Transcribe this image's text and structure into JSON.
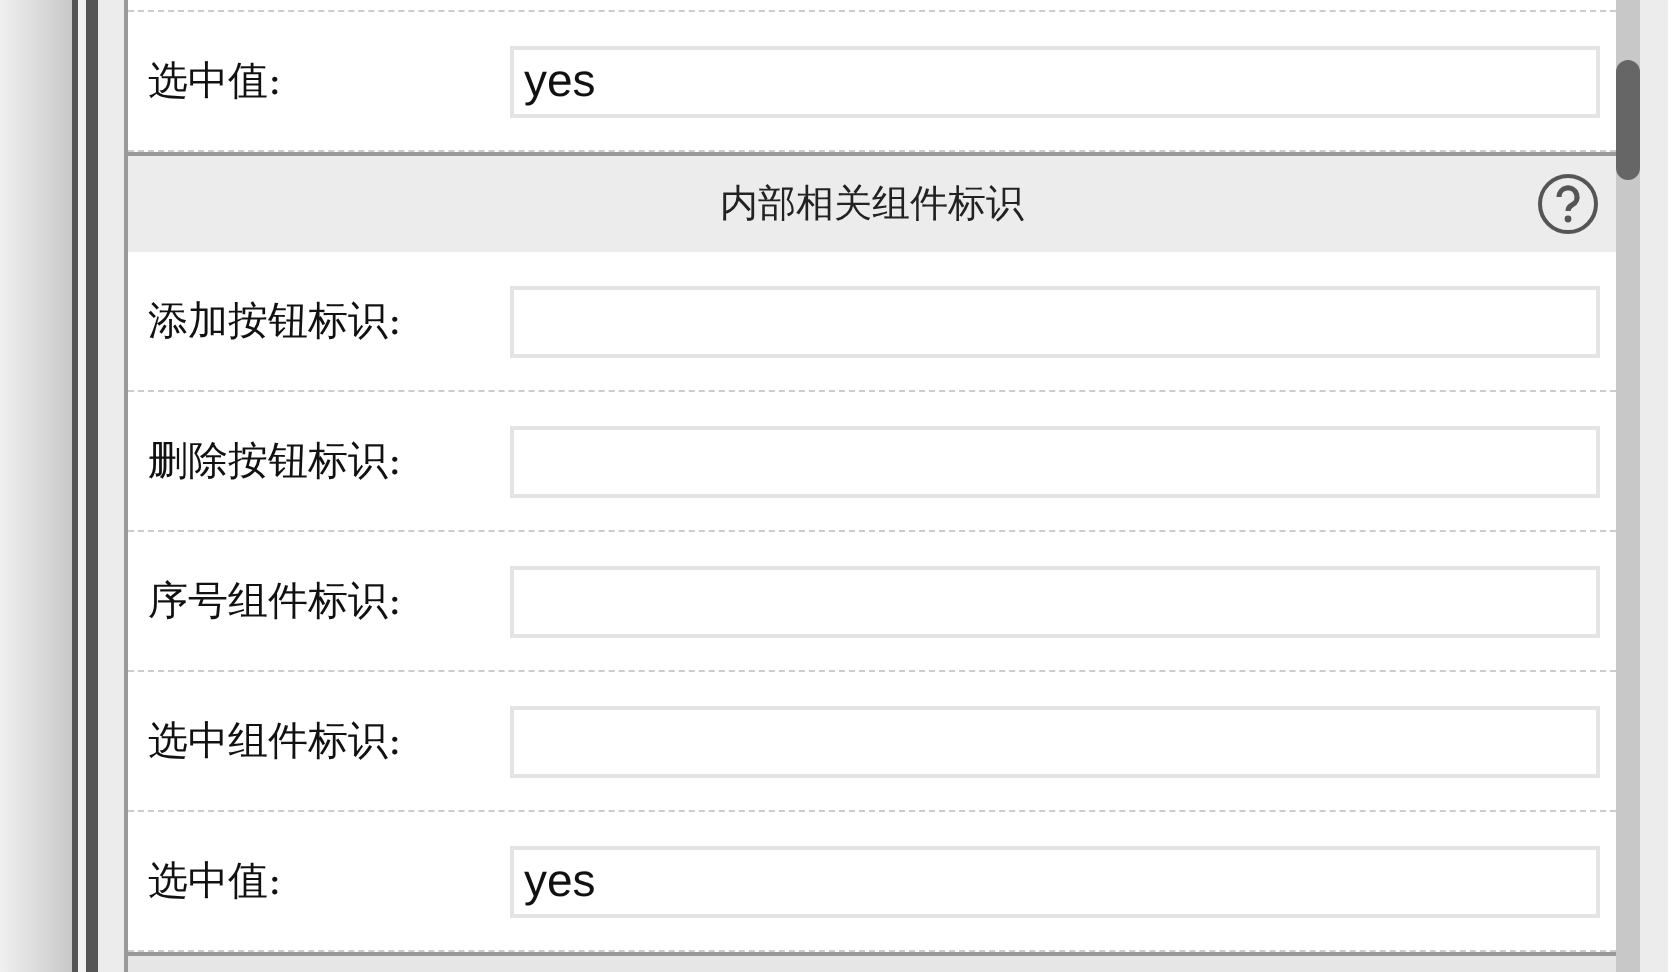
{
  "fields": [
    {
      "label": "选中值:",
      "value": "yes"
    }
  ],
  "section": {
    "title": "内部相关组件标识",
    "fields": [
      {
        "label": "添加按钮标识:"
      },
      {
        "label": "删除按钮标识:"
      },
      {
        "label": "序号组件标识:"
      },
      {
        "label": "选中组件标识:"
      },
      {
        "label": "选中值:",
        "value": "yes"
      }
    ]
  }
}
